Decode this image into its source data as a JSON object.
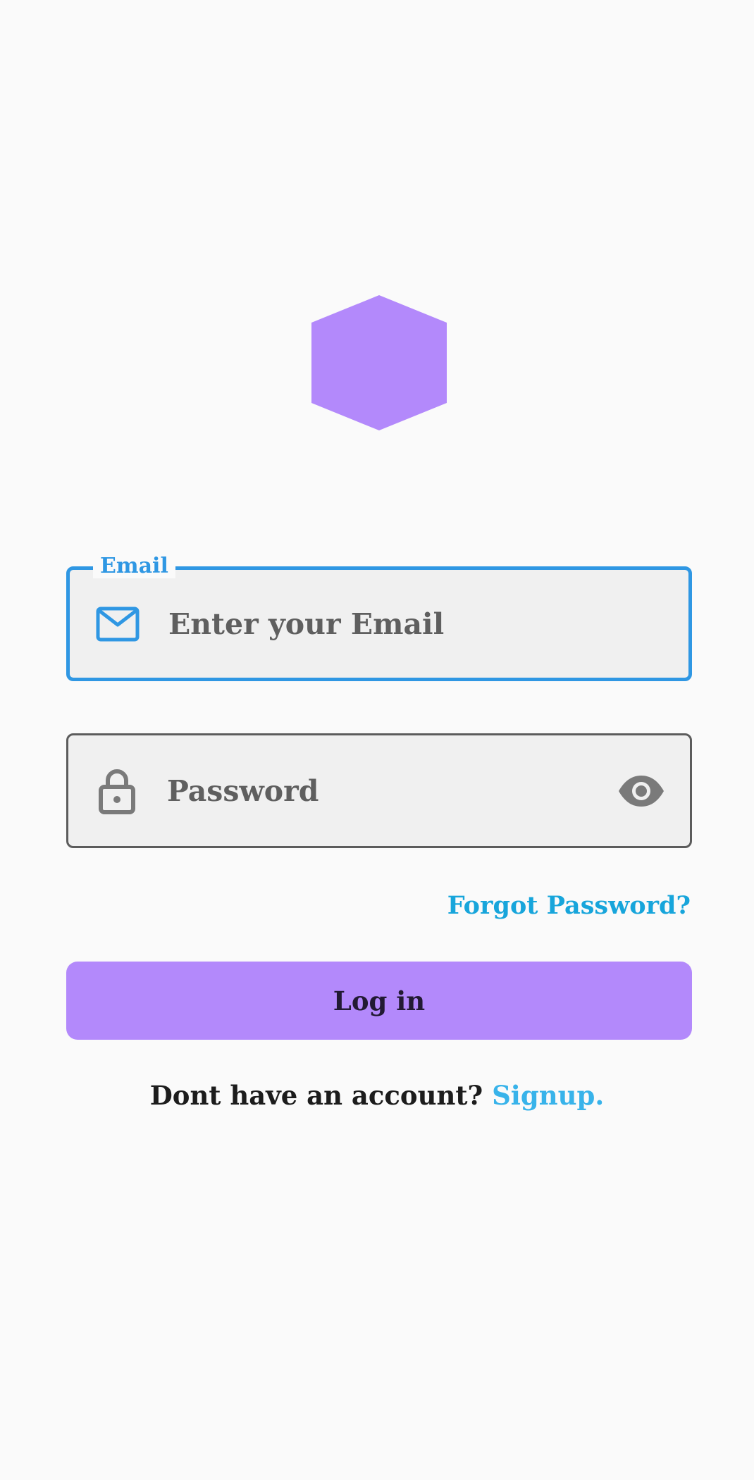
{
  "logo": {
    "shape": "hexagon",
    "color": "#b389fb"
  },
  "email_field": {
    "label": "Email",
    "placeholder": "Enter your Email",
    "icon": "mail-icon",
    "border_color": "#2f97e3",
    "state": "focused"
  },
  "password_field": {
    "placeholder": "Password",
    "icon": "lock-icon",
    "toggle_icon": "eye-icon",
    "border_color": "#5c5c5c"
  },
  "forgot_password": {
    "label": "Forgot Password?",
    "color": "#17a5db"
  },
  "login_button": {
    "label": "Log in",
    "background": "#b389fb"
  },
  "signup": {
    "prompt": "Dont have an account?",
    "link_label": "Signup.",
    "link_color": "#38b3ea"
  }
}
